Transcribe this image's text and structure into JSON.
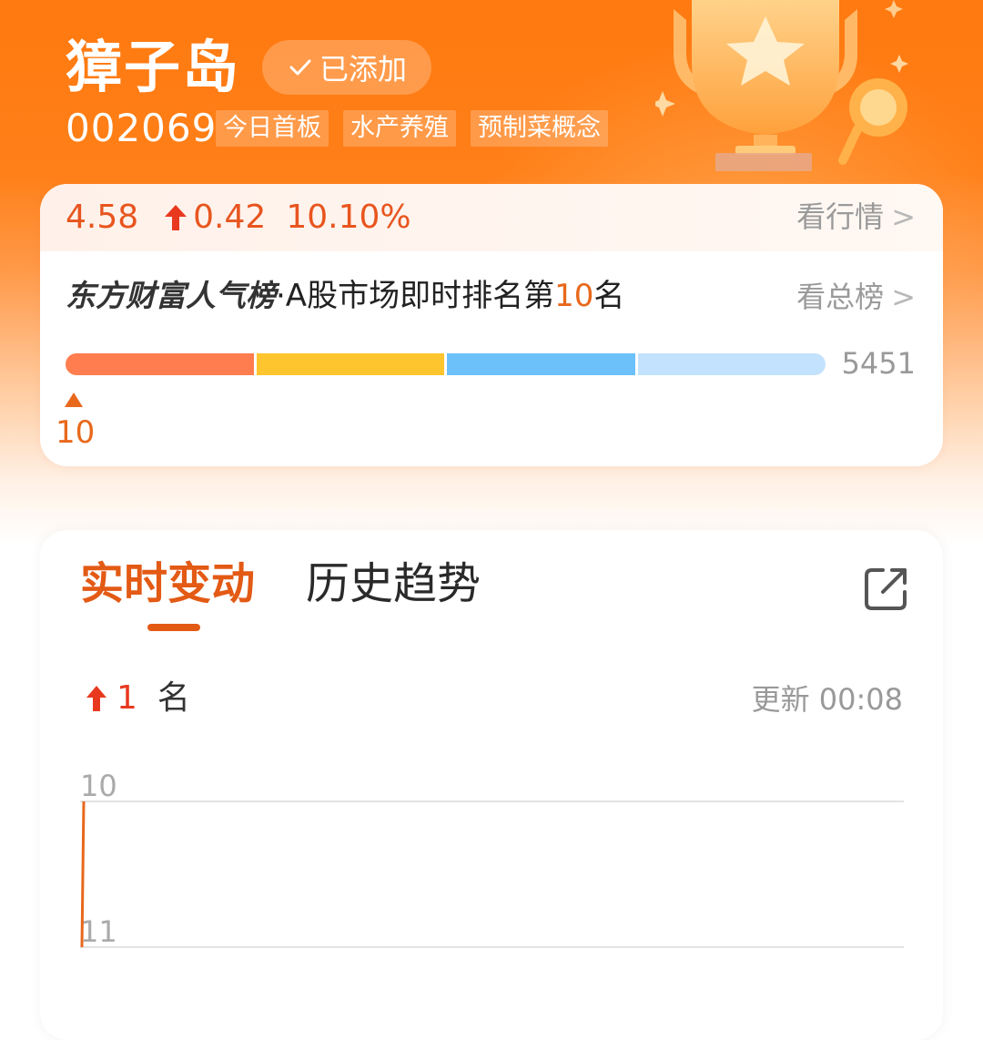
{
  "header": {
    "stock_name": "獐子岛",
    "added_label": "已添加",
    "stock_code": "002069",
    "tags": [
      "今日首板",
      "水产养殖",
      "预制菜概念"
    ]
  },
  "quote": {
    "price": "4.58",
    "change": "0.42",
    "change_pct": "10.10%",
    "view_market_label": "看行情"
  },
  "ranking": {
    "brand": "东方财富人气榜",
    "text_prefix": "·A股市场即时排名第",
    "rank": "10",
    "text_suffix": "名",
    "view_total_label": "看总榜",
    "total": "5451",
    "marker_value": "10",
    "segment_colors": [
      "#ff7d4f",
      "#ffc52e",
      "#6cc1fb",
      "#c3e2fd"
    ]
  },
  "realtime": {
    "tabs": [
      "实时变动",
      "历史趋势"
    ],
    "active_tab": "实时变动",
    "change_value": "1",
    "change_unit": "名",
    "updated_label": "更新 00:08"
  },
  "chart_data": {
    "type": "line",
    "title": "",
    "xlabel": "",
    "ylabel": "",
    "y_ticks": [
      "10",
      "11"
    ],
    "ylim": [
      11,
      10
    ],
    "y_reversed": true,
    "series": [
      {
        "values": [
          11,
          10
        ]
      }
    ],
    "grid": true,
    "line_color": "#e8681c"
  },
  "colors": {
    "accent": "#e35a15",
    "up_red": "#e8391f",
    "brand_orange": "#ff7a10"
  },
  "icons": {
    "added": "check-icon",
    "up": "up-arrow-icon",
    "share": "share-icon",
    "chevron": "chevron-right-icon",
    "trophy": "trophy-illustration"
  }
}
